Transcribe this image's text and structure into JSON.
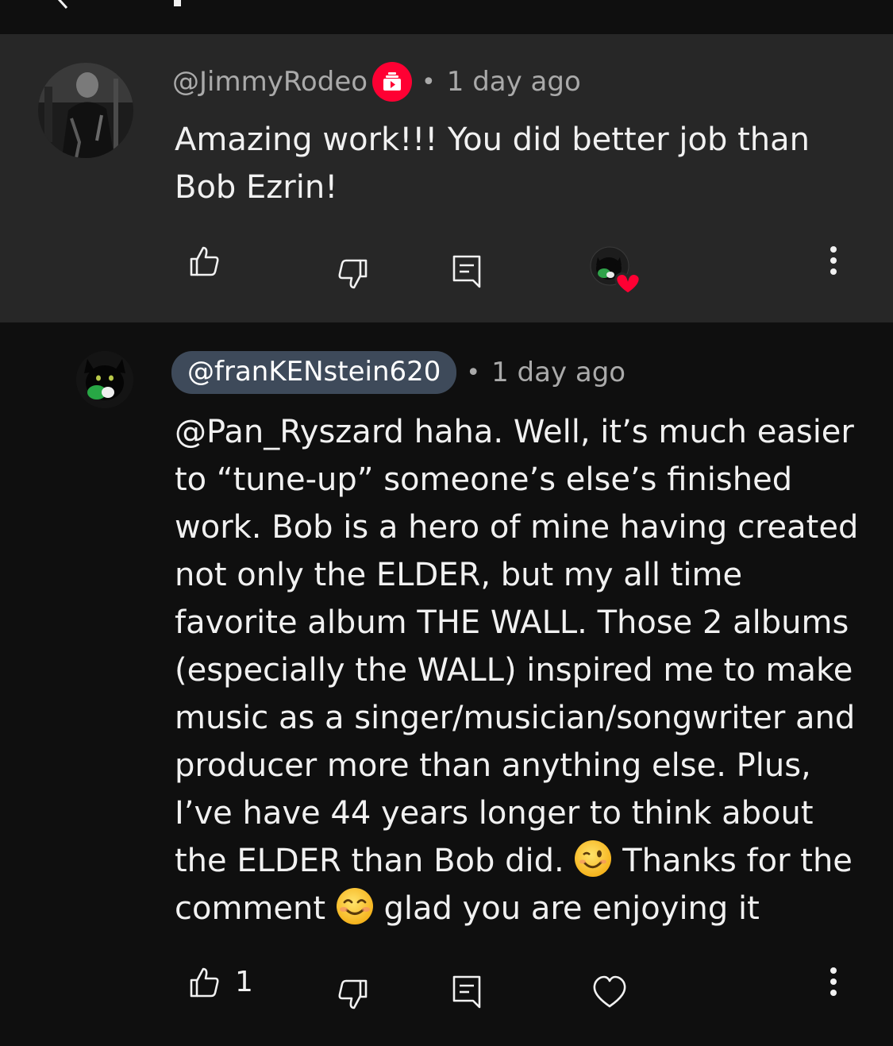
{
  "comments": [
    {
      "handle": "@JimmyRodeo",
      "time": "1 day ago",
      "dot": "•",
      "text": "Amazing work!!! You did better job than Bob Ezrin!",
      "like_count": ""
    },
    {
      "handle": "@franKENstein620",
      "time": "1 day ago",
      "dot": "•",
      "text_parts": {
        "before_wink": "@Pan_Ryszard haha. Well, it’s much easier to “tune-up” someone’s else’s finished work. Bob is a hero of mine having created not only the ELDER, but my all time favorite album THE WALL. Those 2 albums (especially the WALL) inspired me to make music as a singer/musician/songwriter and producer more than anything else. Plus, I’ve have  44 years longer to think about the ELDER than Bob did.",
        "after_wink": " Thanks for the comment ",
        "after_smile": "glad you are enjoying it"
      },
      "like_count": "1"
    }
  ],
  "colors": {
    "background": "#0f0f0f",
    "highlight_background": "#272727",
    "creator_pill": "#3e4a5a",
    "badge_red": "#ff0033",
    "heart_red": "#ff0033"
  },
  "icons": {
    "like": "thumbs-up-icon",
    "dislike": "thumbs-down-icon",
    "reply": "reply-icon",
    "creator_heart": "creator-heart-icon",
    "heart": "heart-icon",
    "more": "more-vertical-icon",
    "member_badge": "member-badge-icon"
  }
}
